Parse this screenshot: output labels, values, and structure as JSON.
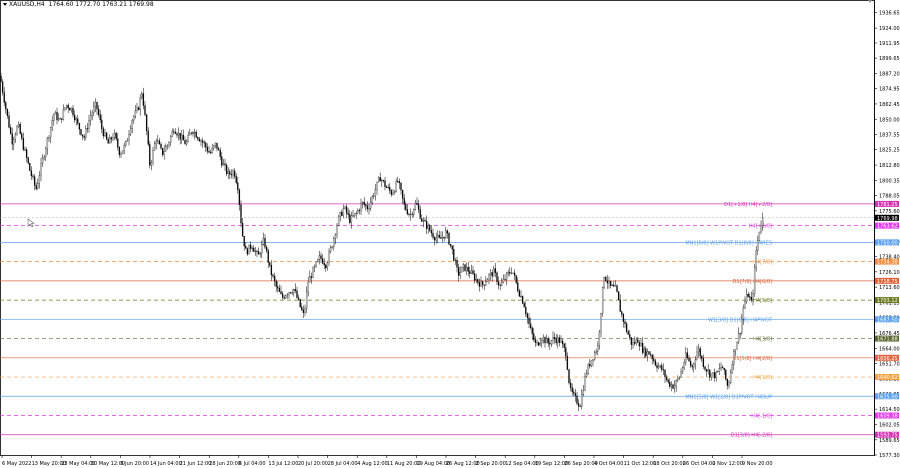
{
  "header": {
    "symbol": "XAUUSD,H4",
    "ohlc": "1764.60 1772.70 1763.21 1769.98"
  },
  "colors": {
    "background": "#ffffff",
    "candle": "#000000",
    "price_label": "#000000"
  },
  "chart_data": {
    "type": "candlestick",
    "symbol": "XAUUSD",
    "timeframe": "H4",
    "ylim": [
      1577.3,
      1942.0
    ],
    "y_ticks": [
      "1936.65",
      "1924.00",
      "1911.95",
      "1899.65",
      "1887.20",
      "1874.95",
      "1862.45",
      "1850.00",
      "1837.55",
      "1825.25",
      "1812.80",
      "1800.35",
      "1788.05",
      "1775.60",
      "1763.15",
      "1750.90",
      "1738.40",
      "1726.10",
      "1713.60",
      "1701.15",
      "1688.90",
      "1676.45",
      "1664.00",
      "1651.70",
      "1639.25",
      "1626.85",
      "1614.50",
      "1602.05",
      "1589.65",
      "1577.30"
    ],
    "x_labels": [
      "6 May 2022",
      "13 May 20:00",
      "23 May 04:00",
      "30 May 12:00",
      "6 Jun 20:00",
      "14 Jun 04:00",
      "21 Jun 12:00",
      "28 Jun 20:00",
      "6 Jul 04:00",
      "13 Jul 12:00",
      "20 Jul 20:00",
      "28 Jul 04:00",
      "4 Aug 12:00",
      "11 Aug 20:00",
      "19 Aug 04:00",
      "26 Aug 12:00",
      "2 Sep 20:00",
      "12 Sep 04:00",
      "19 Sep 12:00",
      "26 Sep 20:00",
      "4 Oct 04:00",
      "11 Oct 12:00",
      "18 Oct 20:00",
      "26 Oct 04:00",
      "2 Nov 12:00",
      "9 Nov 20:00"
    ],
    "price_path": [
      [
        0,
        1885
      ],
      [
        6,
        1858
      ],
      [
        12,
        1832
      ],
      [
        18,
        1845
      ],
      [
        24,
        1826
      ],
      [
        30,
        1808
      ],
      [
        36,
        1793
      ],
      [
        42,
        1815
      ],
      [
        48,
        1835
      ],
      [
        54,
        1855
      ],
      [
        60,
        1848
      ],
      [
        66,
        1862
      ],
      [
        72,
        1858
      ],
      [
        78,
        1845
      ],
      [
        84,
        1835
      ],
      [
        90,
        1852
      ],
      [
        96,
        1862
      ],
      [
        102,
        1842
      ],
      [
        108,
        1830
      ],
      [
        114,
        1838
      ],
      [
        120,
        1822
      ],
      [
        126,
        1830
      ],
      [
        132,
        1850
      ],
      [
        138,
        1858
      ],
      [
        142,
        1873
      ],
      [
        146,
        1845
      ],
      [
        150,
        1812
      ],
      [
        156,
        1835
      ],
      [
        162,
        1822
      ],
      [
        168,
        1830
      ],
      [
        174,
        1843
      ],
      [
        180,
        1836
      ],
      [
        186,
        1830
      ],
      [
        192,
        1842
      ],
      [
        198,
        1836
      ],
      [
        204,
        1830
      ],
      [
        210,
        1822
      ],
      [
        216,
        1830
      ],
      [
        222,
        1815
      ],
      [
        228,
        1805
      ],
      [
        234,
        1808
      ],
      [
        238,
        1795
      ],
      [
        242,
        1758
      ],
      [
        246,
        1742
      ],
      [
        252,
        1748
      ],
      [
        258,
        1738
      ],
      [
        264,
        1752
      ],
      [
        270,
        1728
      ],
      [
        276,
        1714
      ],
      [
        282,
        1705
      ],
      [
        288,
        1710
      ],
      [
        294,
        1712
      ],
      [
        300,
        1698
      ],
      [
        304,
        1690
      ],
      [
        308,
        1718
      ],
      [
        314,
        1728
      ],
      [
        320,
        1738
      ],
      [
        326,
        1732
      ],
      [
        332,
        1748
      ],
      [
        338,
        1768
      ],
      [
        344,
        1778
      ],
      [
        350,
        1768
      ],
      [
        356,
        1773
      ],
      [
        362,
        1782
      ],
      [
        368,
        1778
      ],
      [
        374,
        1790
      ],
      [
        380,
        1803
      ],
      [
        386,
        1795
      ],
      [
        392,
        1790
      ],
      [
        398,
        1800
      ],
      [
        404,
        1780
      ],
      [
        410,
        1772
      ],
      [
        416,
        1782
      ],
      [
        422,
        1768
      ],
      [
        428,
        1762
      ],
      [
        434,
        1755
      ],
      [
        440,
        1752
      ],
      [
        446,
        1758
      ],
      [
        452,
        1744
      ],
      [
        458,
        1724
      ],
      [
        464,
        1730
      ],
      [
        470,
        1726
      ],
      [
        476,
        1720
      ],
      [
        482,
        1715
      ],
      [
        488,
        1722
      ],
      [
        494,
        1726
      ],
      [
        500,
        1714
      ],
      [
        506,
        1722
      ],
      [
        512,
        1728
      ],
      [
        518,
        1712
      ],
      [
        524,
        1700
      ],
      [
        530,
        1680
      ],
      [
        536,
        1666
      ],
      [
        542,
        1673
      ],
      [
        548,
        1668
      ],
      [
        554,
        1672
      ],
      [
        560,
        1670
      ],
      [
        566,
        1660
      ],
      [
        570,
        1630
      ],
      [
        576,
        1622
      ],
      [
        580,
        1618
      ],
      [
        586,
        1644
      ],
      [
        592,
        1656
      ],
      [
        598,
        1666
      ],
      [
        604,
        1724
      ],
      [
        610,
        1714
      ],
      [
        616,
        1712
      ],
      [
        620,
        1696
      ],
      [
        626,
        1680
      ],
      [
        632,
        1667
      ],
      [
        638,
        1671
      ],
      [
        644,
        1661
      ],
      [
        650,
        1660
      ],
      [
        656,
        1651
      ],
      [
        662,
        1647
      ],
      [
        668,
        1636
      ],
      [
        674,
        1633
      ],
      [
        680,
        1642
      ],
      [
        686,
        1658
      ],
      [
        692,
        1648
      ],
      [
        698,
        1664
      ],
      [
        704,
        1650
      ],
      [
        710,
        1643
      ],
      [
        716,
        1642
      ],
      [
        722,
        1650
      ],
      [
        728,
        1632
      ],
      [
        732,
        1653
      ],
      [
        736,
        1668
      ],
      [
        740,
        1678
      ],
      [
        744,
        1700
      ],
      [
        748,
        1708
      ],
      [
        752,
        1700
      ],
      [
        756,
        1742
      ],
      [
        760,
        1763
      ],
      [
        763,
        1770
      ]
    ],
    "last_price": "1769.98",
    "levels": [
      {
        "label": "D1[+1/8] H4[+2/8]",
        "price": "1781.25",
        "value": 1781.25,
        "color": "#d633b4",
        "style": "solid"
      },
      {
        "label": "H4[+1/8]",
        "price": "1763.62",
        "value": 1763.62,
        "color": "#e23aea",
        "style": "dash"
      },
      {
        "label": "MN1[8/8] W1PIVOT D1[8/8] H4RES",
        "price": "1750.00",
        "value": 1750.0,
        "color": "#5aa0ec",
        "style": "solid"
      },
      {
        "label": "H4[7/8]",
        "price": "1734.38",
        "value": 1734.38,
        "color": "#f28e3c",
        "style": "dash"
      },
      {
        "label": "D1[7/8] H4[6/8]",
        "price": "1718.75",
        "value": 1718.75,
        "color": "#e2643c",
        "style": "solid"
      },
      {
        "label": "H4[5/8]",
        "price": "1703.12",
        "value": 1703.12,
        "color": "#6b7a1e",
        "style": "dash"
      },
      {
        "label": "W1[3/8] D1[6/8] H4PIVOT",
        "price": "1687.50",
        "value": 1687.5,
        "color": "#5aa0ec",
        "style": "solid"
      },
      {
        "label": "H4[3/8]",
        "price": "1671.88",
        "value": 1671.88,
        "color": "#5a6a32",
        "style": "dash"
      },
      {
        "label": "D1[5/8] H4[2/8]",
        "price": "1656.25",
        "value": 1656.25,
        "color": "#e2643c",
        "style": "solid"
      },
      {
        "label": "H4[1/8]",
        "price": "1640.62",
        "value": 1640.62,
        "color": "#f2a23c",
        "style": "dash"
      },
      {
        "label": "MN1[5/8] W1[2/8] D1PIVOT H4SUP",
        "price": "1625.00",
        "value": 1625.0,
        "color": "#5aa0ec",
        "style": "solid"
      },
      {
        "label": "H4[-1/8]",
        "price": "1609.38",
        "value": 1609.38,
        "color": "#e23aea",
        "style": "dash"
      },
      {
        "label": "D1[3/8] H4[-2/8]",
        "price": "1593.75",
        "value": 1593.75,
        "color": "#d633b4",
        "style": "solid"
      }
    ]
  }
}
